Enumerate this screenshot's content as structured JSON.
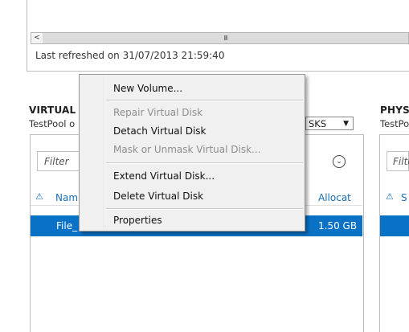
{
  "top_panel": {
    "scroll_grip": "III",
    "scroll_left_arrow": "<",
    "last_refreshed": "Last refreshed on 31/07/2013 21:59:40"
  },
  "virtual_disks": {
    "title": "VIRTUAL",
    "subtitle": "TestPool o",
    "tasks_label": "SKS",
    "filter_placeholder": "Filter",
    "columns": {
      "name": "Nam",
      "allocated": "Allocat"
    },
    "selected_row": {
      "name": "File_",
      "allocated": "1.50 GB"
    }
  },
  "physical_disks": {
    "title": "PHYS",
    "subtitle": "TestPo",
    "filter_placeholder": "Filte",
    "column": "S"
  },
  "context_menu": {
    "items": [
      {
        "label": "New Volume...",
        "disabled": false
      },
      {
        "label": "Repair Virtual Disk",
        "disabled": true
      },
      {
        "label": "Detach Virtual Disk",
        "disabled": false
      },
      {
        "label": "Mask or Unmask Virtual Disk...",
        "disabled": true
      },
      {
        "label": "Extend Virtual Disk...",
        "disabled": false
      },
      {
        "label": "Delete Virtual Disk",
        "disabled": false
      },
      {
        "label": "Properties",
        "disabled": false
      }
    ]
  },
  "colors": {
    "selection": "#0a72c6",
    "header_link": "#1a6fb5",
    "menu_bg": "#f0f0f0"
  },
  "icons": {
    "warning": "warning-triangle-icon",
    "expand": "chevron-down-circle-icon",
    "dropdown": "triangle-down-icon"
  }
}
